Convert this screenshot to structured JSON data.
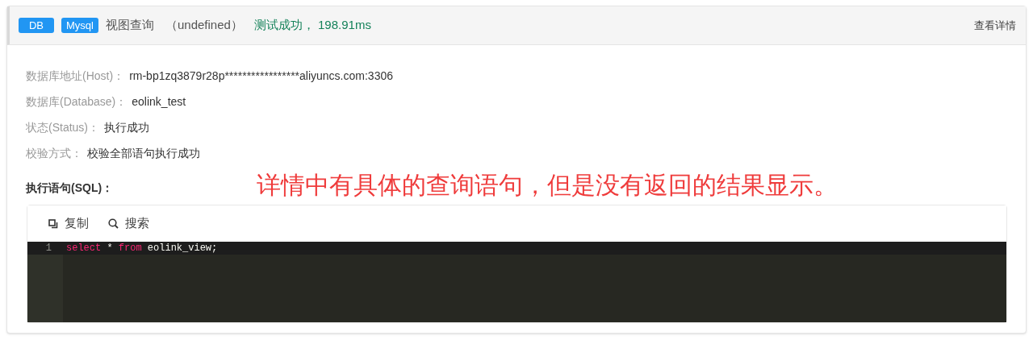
{
  "header": {
    "tags": [
      "DB",
      "Mysql"
    ],
    "title": "视图查询",
    "subtitle": "（undefined）",
    "result": "测试成功， 198.91ms",
    "link": "查看详情"
  },
  "fields": [
    {
      "label": "数据库地址(Host)：",
      "value": "rm-bp1zq3879r28p*****************aliyuncs.com:3306"
    },
    {
      "label": "数据库(Database)：",
      "value": "eolink_test"
    },
    {
      "label": "状态(Status)：",
      "value": "执行成功"
    },
    {
      "label": "校验方式：",
      "value": "校验全部语句执行成功"
    }
  ],
  "sql_label": "执行语句(SQL)：",
  "annotation": "详情中有具体的查询语句，但是没有返回的结果显示。",
  "toolbar": [
    {
      "kind": "copy",
      "label": "复制"
    },
    {
      "kind": "search",
      "label": "搜索"
    }
  ],
  "code_lines": [
    {
      "number": "1",
      "tokens": [
        {
          "kind": "keyword",
          "text": "select"
        },
        {
          "kind": "plain",
          "text": " * "
        },
        {
          "kind": "keyword",
          "text": "from"
        },
        {
          "kind": "plain",
          "text": " eolink_view;"
        }
      ]
    }
  ]
}
